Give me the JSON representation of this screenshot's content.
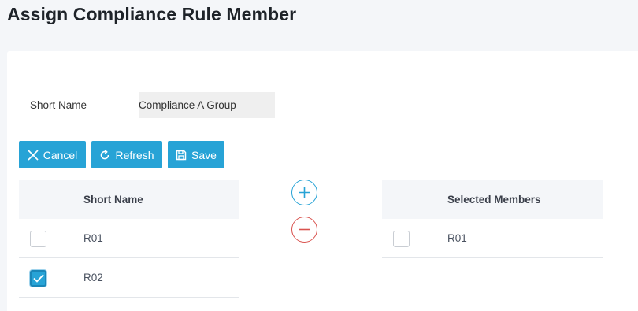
{
  "page": {
    "title": "Assign Compliance Rule Member"
  },
  "form": {
    "short_name_label": "Short Name",
    "short_name_value": "Compliance A Group"
  },
  "toolbar": {
    "cancel_label": "Cancel",
    "refresh_label": "Refresh",
    "save_label": "Save"
  },
  "available": {
    "header": "Short Name",
    "rows": [
      {
        "label": "R01",
        "checked": false
      },
      {
        "label": "R02",
        "checked": true
      }
    ]
  },
  "selected": {
    "header": "Selected Members",
    "rows": [
      {
        "label": "R01",
        "checked": false
      }
    ]
  },
  "icons": {
    "cancel": "close-icon",
    "refresh": "refresh-icon",
    "save": "floppy-disk-icon",
    "add": "plus-circle-icon",
    "remove": "minus-circle-icon",
    "check": "checkmark-icon"
  },
  "colors": {
    "accent": "#27a3d6",
    "danger": "#d9534f",
    "background": "#f4f6f9"
  }
}
